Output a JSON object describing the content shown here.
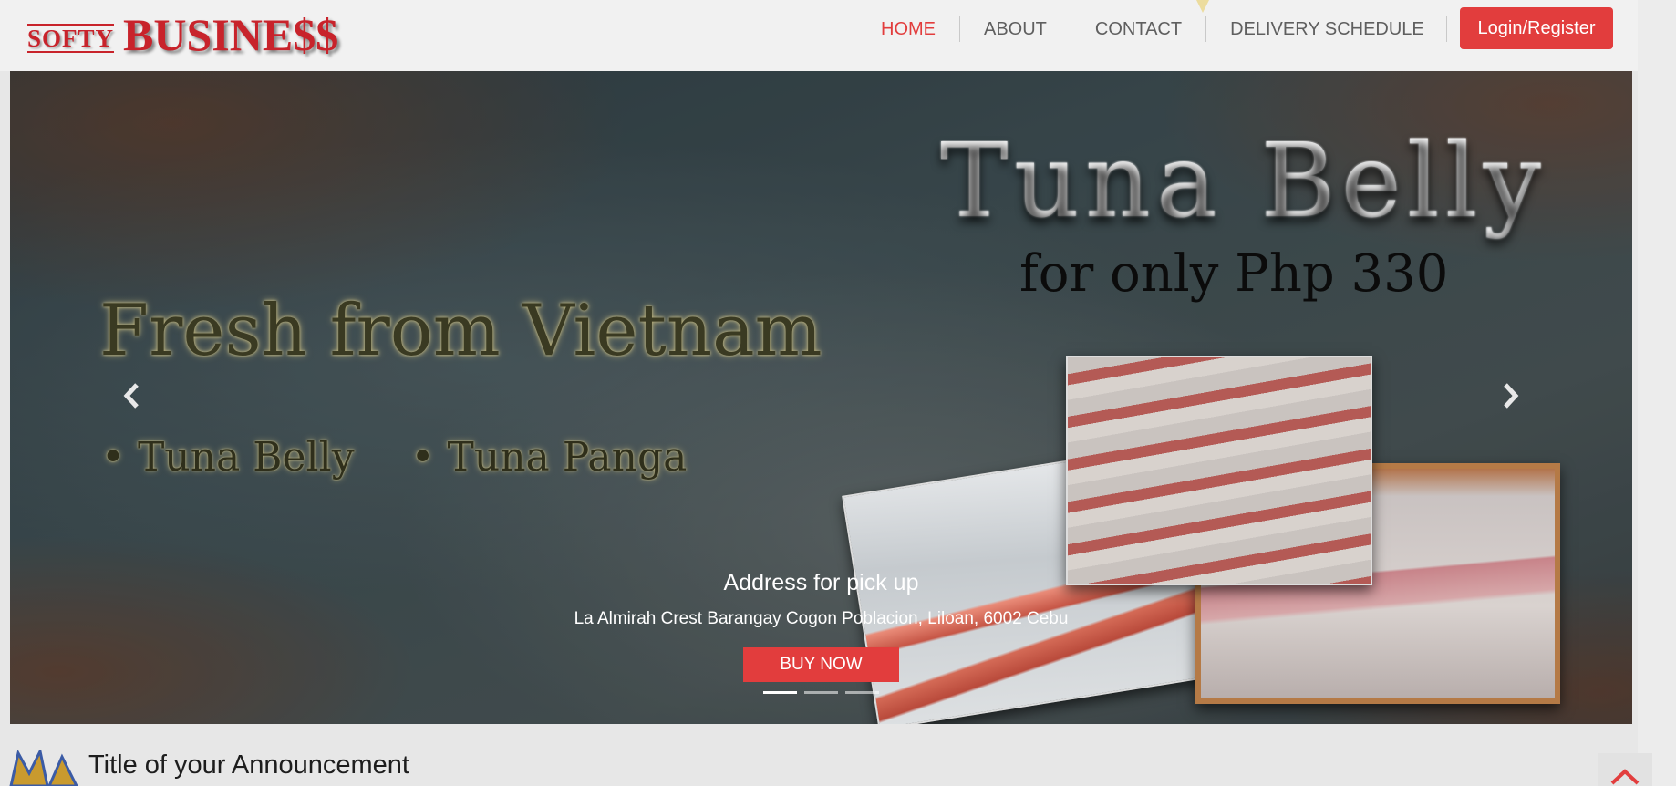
{
  "brand": {
    "prefix": "SOFTY",
    "name": "BUSINE$$"
  },
  "nav": {
    "items": [
      {
        "label": "HOME",
        "active": true
      },
      {
        "label": "ABOUT",
        "active": false
      },
      {
        "label": "CONTACT",
        "active": false
      },
      {
        "label": "DELIVERY SCHEDULE",
        "active": false
      }
    ],
    "login_label": "Login/Register"
  },
  "banner": {
    "headline": "Tuna Belly",
    "price": "for only Php 330",
    "origin": "Fresh from Vietnam",
    "products": [
      "• Tuna Belly",
      "• Tuna Panga"
    ]
  },
  "carousel": {
    "caption_title": "Address for pick up",
    "caption_text": "La Almirah Crest Barangay Cogon Poblacion, Liloan, 6002 Cebu",
    "cta_label": "BUY NOW",
    "slide_count": 3,
    "active_slide": 1,
    "prev_icon": "chevron-left-icon",
    "next_icon": "chevron-right-icon"
  },
  "announcement": {
    "title": "Title of your Announcement"
  },
  "colors": {
    "accent": "#e23d3d",
    "brand_red": "#c8232b",
    "nav_text": "#5f5f5f"
  }
}
